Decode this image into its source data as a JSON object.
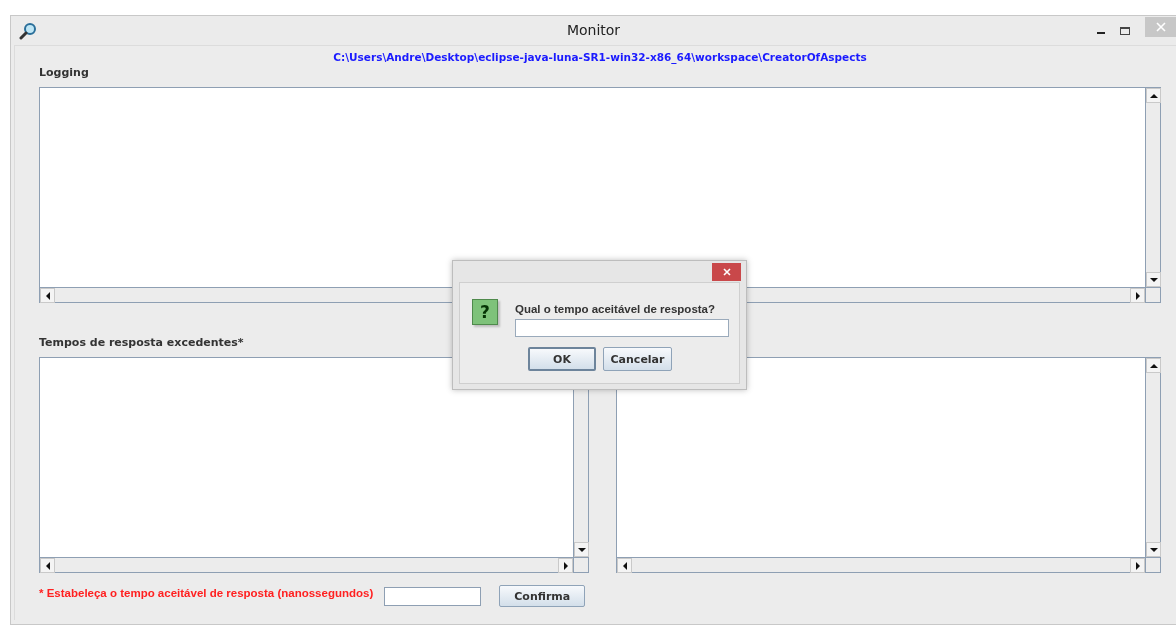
{
  "window": {
    "title": "Monitor"
  },
  "path": "C:\\Users\\Andre\\Desktop\\eclipse-java-luna-SR1-win32-x86_64\\workspace\\CreatorOfAspects",
  "logging": {
    "label": "Logging"
  },
  "excess": {
    "label": "Tempos de resposta excedentes*"
  },
  "threshold": {
    "label": "* Estabeleça o tempo aceitável de resposta (nanossegundos)",
    "button": "Confirma"
  },
  "dialog": {
    "icon": "?",
    "message": "Qual o tempo aceitável de resposta?",
    "buttons": [
      {
        "label": "OK",
        "focused": true
      },
      {
        "label": "Cancelar",
        "focused": false
      }
    ]
  }
}
